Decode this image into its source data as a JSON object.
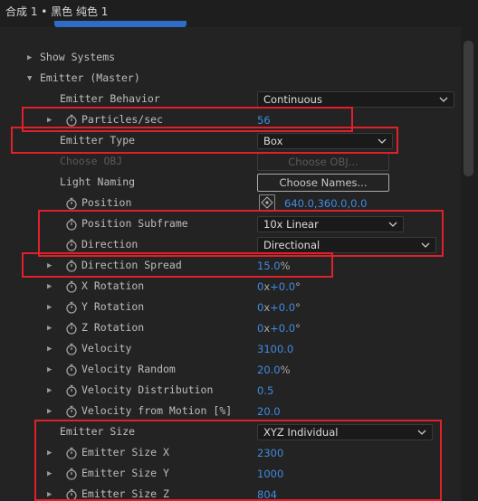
{
  "header": {
    "breadcrumb": "合成 1 • 黑色 纯色 1"
  },
  "rows": {
    "show_systems": {
      "label": "Show Systems"
    },
    "emitter_master": {
      "label": "Emitter (Master)"
    },
    "emitter_behavior": {
      "label": "Emitter Behavior",
      "value": "Continuous"
    },
    "particles_sec": {
      "label": "Particles/sec",
      "value": "56"
    },
    "emitter_type": {
      "label": "Emitter Type",
      "value": "Box"
    },
    "choose_obj": {
      "label": "Choose OBJ",
      "button": "Choose OBJ..."
    },
    "light_naming": {
      "label": "Light Naming",
      "button": "Choose Names..."
    },
    "position": {
      "label": "Position",
      "value": "640.0,360.0,0.0"
    },
    "position_subframe": {
      "label": "Position Subframe",
      "value": "10x Linear"
    },
    "direction": {
      "label": "Direction",
      "value": "Directional"
    },
    "direction_spread": {
      "label": "Direction Spread",
      "value": "15.0",
      "unit": "%"
    },
    "x_rotation": {
      "label": "X Rotation",
      "turns": "0",
      "x": "x",
      "degrees": "+0.0",
      "deg": "°"
    },
    "y_rotation": {
      "label": "Y Rotation",
      "turns": "0",
      "x": "x",
      "degrees": "+0.0",
      "deg": "°"
    },
    "z_rotation": {
      "label": "Z Rotation",
      "turns": "0",
      "x": "x",
      "degrees": "+0.0",
      "deg": "°"
    },
    "velocity": {
      "label": "Velocity",
      "value": "3100.0"
    },
    "velocity_random": {
      "label": "Velocity Random",
      "value": "20.0",
      "unit": "%"
    },
    "velocity_distribution": {
      "label": "Velocity Distribution",
      "value": "0.5"
    },
    "velocity_from_motion": {
      "label": "Velocity from Motion [%]",
      "value": "20.0"
    },
    "emitter_size": {
      "label": "Emitter Size",
      "value": "XYZ Individual"
    },
    "emitter_size_x": {
      "label": "Emitter Size X",
      "value": "2300"
    },
    "emitter_size_y": {
      "label": "Emitter Size Y",
      "value": "1000"
    },
    "emitter_size_z": {
      "label": "Emitter Size Z",
      "value": "804"
    }
  },
  "colors": {
    "value_blue": "#3f8be0",
    "highlight_red": "#e0202a",
    "tab_blue": "#2d6cc8"
  },
  "icons": {
    "twirl_closed": "triangle-right-icon",
    "twirl_open": "triangle-down-icon",
    "stopwatch": "stopwatch-icon",
    "chevron": "chevron-down-icon",
    "target": "position-target-icon"
  }
}
